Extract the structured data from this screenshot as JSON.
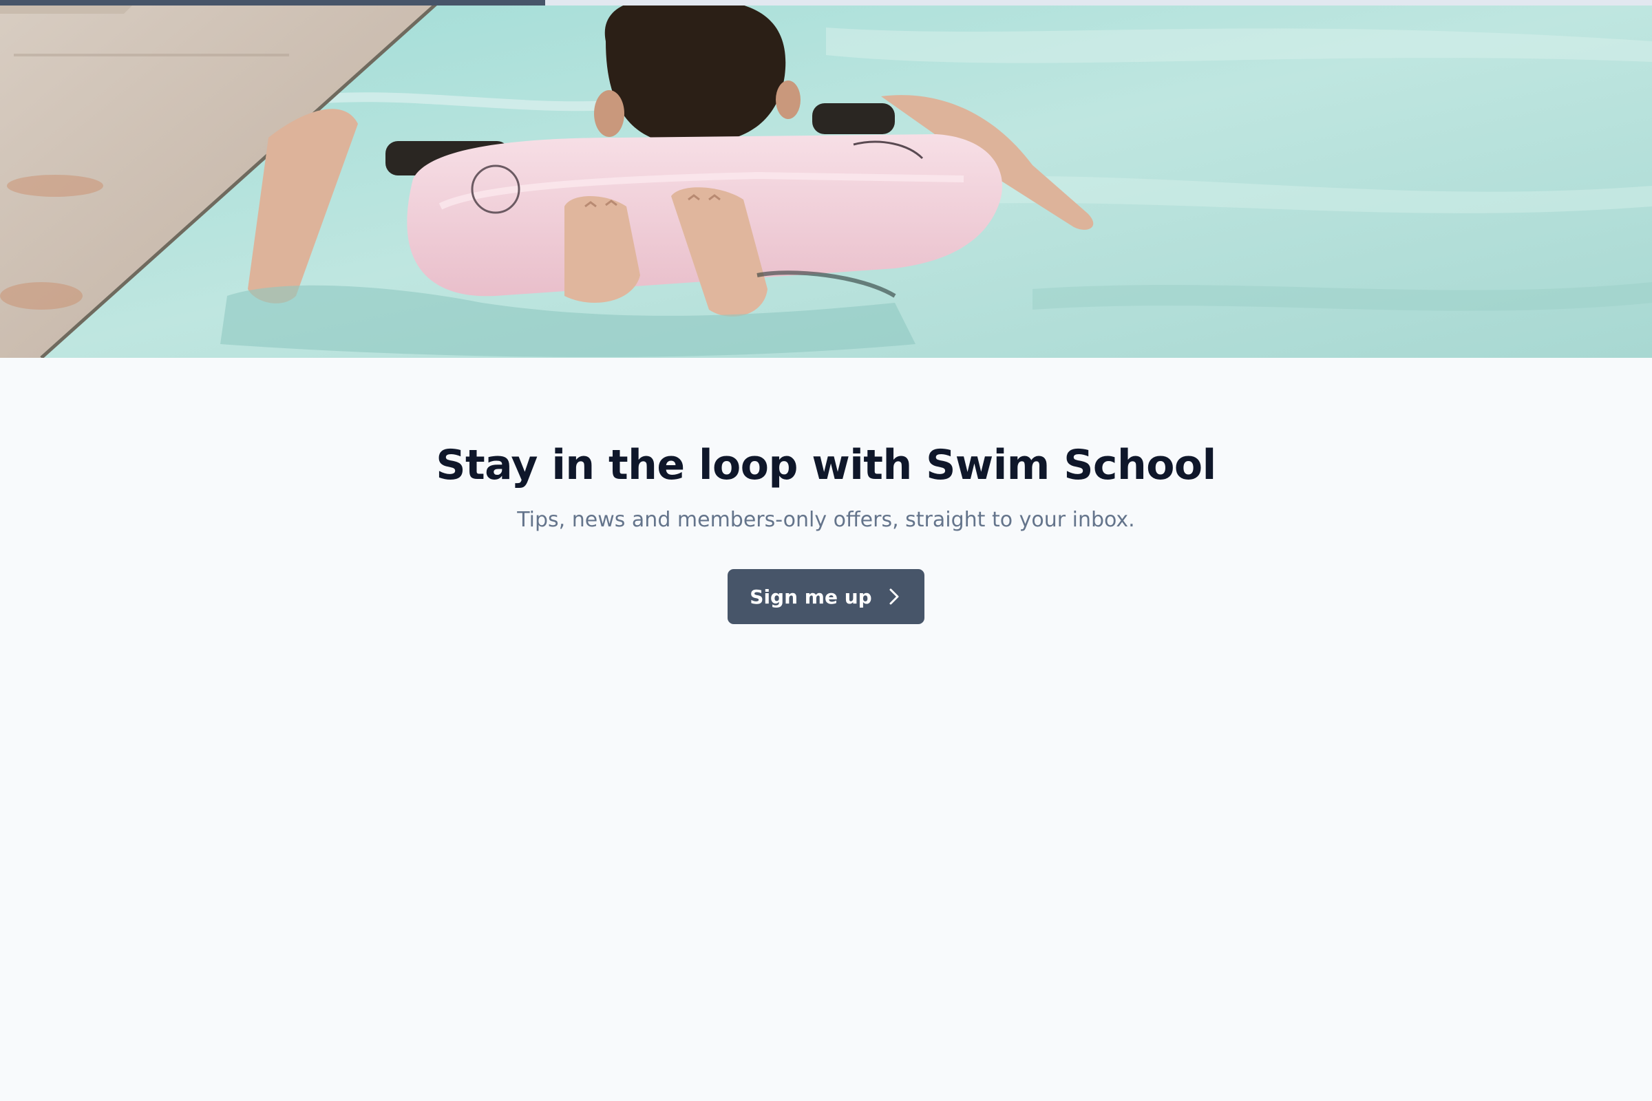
{
  "progress": {
    "value": 0.33,
    "fill_color": "#475569",
    "track_color": "#e2e8f0"
  },
  "hero": {
    "image": "child-swimming-with-pink-float-photo",
    "colors": {
      "water": "#b9e4df",
      "float": "#f0d3dc",
      "deck": "#cdbfb2"
    }
  },
  "newsletter": {
    "title": "Stay in the loop with Swim School",
    "subtitle": "Tips, news and members-only offers, straight to your inbox.",
    "cta_label": "Sign me up",
    "cta_icon": "chevron-right-icon",
    "cta_color": "#475569"
  }
}
